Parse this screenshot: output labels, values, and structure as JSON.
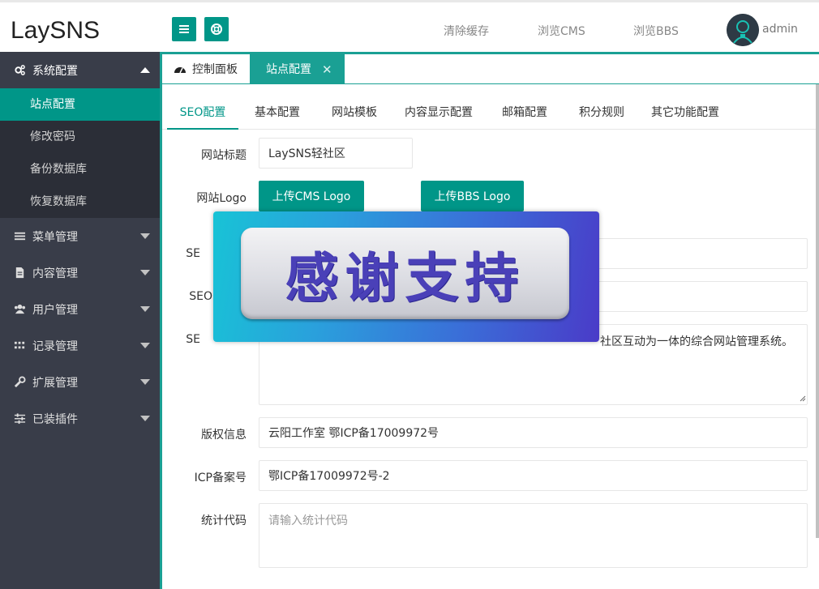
{
  "header": {
    "logo": "LaySNS",
    "links": [
      "清除缓存",
      "浏览CMS",
      "浏览BBS"
    ],
    "user": "admin"
  },
  "sidebar": {
    "groups": [
      {
        "label": "系统配置",
        "icon": "gear-icon",
        "open": true,
        "items": [
          "站点配置",
          "修改密码",
          "备份数据库",
          "恢复数据库"
        ],
        "active_item": "站点配置"
      },
      {
        "label": "菜单管理",
        "icon": "menu-icon"
      },
      {
        "label": "内容管理",
        "icon": "document-icon"
      },
      {
        "label": "用户管理",
        "icon": "users-icon"
      },
      {
        "label": "记录管理",
        "icon": "grid-icon"
      },
      {
        "label": "扩展管理",
        "icon": "wrench-icon"
      },
      {
        "label": "已装插件",
        "icon": "sliders-icon"
      }
    ]
  },
  "tabs": {
    "home": "控制面板",
    "current": "站点配置",
    "close_symbol": "✕"
  },
  "subtabs": {
    "items": [
      "SEO配置",
      "基本配置",
      "网站模板",
      "内容显示配置",
      "邮箱配置",
      "积分规则",
      "其它功能配置"
    ],
    "active": "SEO配置"
  },
  "form": {
    "site_title": {
      "label": "网站标题",
      "value": "LaySNS轻社区"
    },
    "site_logo": {
      "label": "网站Logo",
      "cms_button": "上传CMS Logo",
      "bbs_button": "上传BBS Logo"
    },
    "seo_title": {
      "label_visible": "SE"
    },
    "seo_keywords": {
      "label_visible": "SEO"
    },
    "seo_description": {
      "label_visible": "SE",
      "value_visible": "社区互动为一体的综合网站管理系统。"
    },
    "copyright": {
      "label": "版权信息",
      "value": "云阳工作室  鄂ICP备17009972号"
    },
    "icp": {
      "label": "ICP备案号",
      "value": "鄂ICP备17009972号-2"
    },
    "stats_code": {
      "label": "统计代码",
      "placeholder": "请输入统计代码"
    }
  },
  "overlay": {
    "text": "感谢支持"
  },
  "colors": {
    "accent": "#009688",
    "tab_accent": "#1aa094",
    "sidebar_bg": "#393d49",
    "sidebar_sub_bg": "#2b2e37"
  }
}
